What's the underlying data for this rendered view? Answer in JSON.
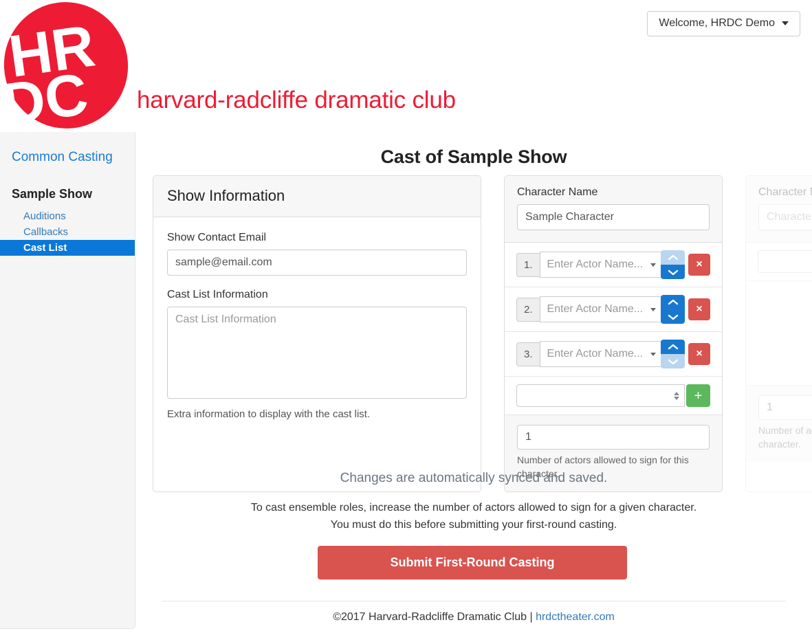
{
  "header": {
    "welcome_label": "Welcome, HRDC Demo",
    "brand_text": "harvard-radcliffe dramatic club",
    "logo_letters": "HRDC",
    "brand_color": "#ed1c34"
  },
  "sidebar": {
    "common_casting": "Common Casting",
    "show_heading": "Sample Show",
    "items": [
      {
        "label": "Auditions",
        "active": false
      },
      {
        "label": "Callbacks",
        "active": false
      },
      {
        "label": "Cast List",
        "active": true
      }
    ],
    "active_color": "#0a78d8"
  },
  "main": {
    "page_title": "Cast of Sample Show"
  },
  "show_card": {
    "title": "Show Information",
    "email_label": "Show Contact Email",
    "email_value": "sample@email.com",
    "cast_info_label": "Cast List Information",
    "cast_info_placeholder": "Cast List Information",
    "cast_info_value": "",
    "cast_info_help": "Extra information to display with the cast list."
  },
  "character_cards": [
    {
      "name_label": "Character Name",
      "name_value": "Sample Character",
      "name_placeholder": "Character Name",
      "rows": [
        {
          "number": "1.",
          "placeholder": "Enter Actor Name...",
          "value": "",
          "up_enabled": false,
          "down_enabled": true
        },
        {
          "number": "2.",
          "placeholder": "Enter Actor Name...",
          "value": "",
          "up_enabled": true,
          "down_enabled": true
        },
        {
          "number": "3.",
          "placeholder": "Enter Actor Name...",
          "value": "",
          "up_enabled": true,
          "down_enabled": false
        }
      ],
      "add_select_value": "",
      "add_button_label": "+",
      "delete_button_label": "×",
      "count_value": "1",
      "count_help": "Number of actors allowed to sign for this character."
    },
    {
      "name_label": "Character Name",
      "name_value": "",
      "name_placeholder": "Character Name",
      "rows": [],
      "add_select_value": "",
      "add_button_label": "+",
      "delete_button_label": "×",
      "count_value": "1",
      "count_help": "Number of actors allowed to sign for this character."
    }
  ],
  "bottom": {
    "sync_note": "Changes are automatically synced and saved.",
    "ensemble_note": "To cast ensemble roles, increase the number of actors allowed to sign for a given character. You must do this before submitting your first-round casting.",
    "submit_label": "Submit First-Round Casting",
    "submit_color": "#d9534f"
  },
  "footer": {
    "copyright": "©2017 Harvard-Radcliffe Dramatic Club | ",
    "link": "hrdctheater.com"
  }
}
